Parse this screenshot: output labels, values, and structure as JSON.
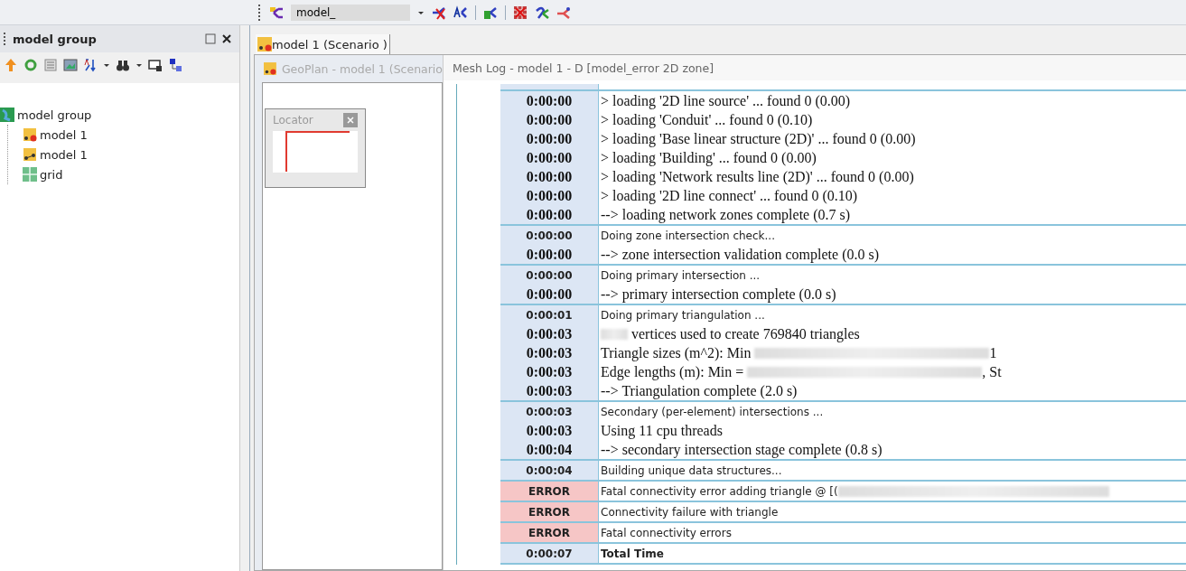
{
  "toolbar": {
    "model_field": {
      "value": "model_"
    }
  },
  "side_panel": {
    "title": "model group",
    "tree": [
      {
        "label": "model group",
        "kind": "group",
        "children": [
          {
            "label": "model 1",
            "kind": "model-error",
            "selected": false
          },
          {
            "label": "model 1",
            "kind": "model",
            "selected": false
          },
          {
            "label": "grid",
            "kind": "grid",
            "selected": false
          }
        ]
      }
    ]
  },
  "document_tab": {
    "label": "model 1 (Scenario )"
  },
  "geoplan": {
    "title": "GeoPlan - model 1 (Scenario",
    "locator": {
      "title": "Locator"
    }
  },
  "mesh_log": {
    "title": "Mesh Log - model 1 - D [model_error 2D zone]",
    "groups": [
      {
        "rows": [
          {
            "kind": "detail",
            "time": "0:00:00",
            "parts": [
              {
                "text": "> loading '2D line source' ... found 0 (0.00)"
              }
            ]
          },
          {
            "kind": "detail",
            "time": "0:00:00",
            "parts": [
              {
                "text": "> loading 'Conduit' ... found 0 (0.10)"
              }
            ]
          },
          {
            "kind": "detail",
            "time": "0:00:00",
            "parts": [
              {
                "text": "> loading 'Base linear structure (2D)' ... found 0 (0.00)"
              }
            ]
          },
          {
            "kind": "detail",
            "time": "0:00:00",
            "parts": [
              {
                "text": "> loading 'Building' ... found 0 (0.00)"
              }
            ]
          },
          {
            "kind": "detail",
            "time": "0:00:00",
            "parts": [
              {
                "text": "> loading 'Network results line (2D)' ... found 0 (0.00)"
              }
            ]
          },
          {
            "kind": "detail",
            "time": "0:00:00",
            "parts": [
              {
                "text": "> loading '2D line connect' ... found 0 (0.10)"
              }
            ]
          },
          {
            "kind": "detail",
            "time": "0:00:00",
            "parts": [
              {
                "text": "--> loading network zones complete (0.7 s)"
              }
            ]
          }
        ]
      },
      {
        "rows": [
          {
            "kind": "heading",
            "time": "0:00:00",
            "parts": [
              {
                "text": "Doing zone intersection check..."
              }
            ]
          },
          {
            "kind": "detail",
            "time": "0:00:00",
            "parts": [
              {
                "text": "--> zone intersection validation complete (0.0 s)"
              }
            ]
          }
        ]
      },
      {
        "rows": [
          {
            "kind": "heading",
            "time": "0:00:00",
            "parts": [
              {
                "text": "Doing primary intersection ..."
              }
            ]
          },
          {
            "kind": "detail",
            "time": "0:00:00",
            "parts": [
              {
                "text": "--> primary intersection complete (0.0 s)"
              }
            ]
          }
        ]
      },
      {
        "rows": [
          {
            "kind": "heading",
            "time": "0:00:01",
            "parts": [
              {
                "text": "Doing primary triangulation ..."
              }
            ]
          },
          {
            "kind": "detail",
            "time": "0:00:03",
            "parts": [
              {
                "kind": "blurred"
              },
              {
                "text": " vertices used to create 769840 triangles"
              }
            ]
          },
          {
            "kind": "detail",
            "time": "0:00:03",
            "parts": [
              {
                "text": "Triangle sizes (m^2): Min "
              },
              {
                "kind": "blurred"
              },
              {
                "text": "1"
              }
            ]
          },
          {
            "kind": "detail",
            "time": "0:00:03",
            "parts": [
              {
                "text": "Edge lengths (m): Min = "
              },
              {
                "kind": "blurred"
              },
              {
                "text": ", St"
              }
            ]
          },
          {
            "kind": "detail",
            "time": "0:00:03",
            "parts": [
              {
                "text": "--> Triangulation complete (2.0 s)"
              }
            ]
          }
        ]
      },
      {
        "rows": [
          {
            "kind": "heading",
            "time": "0:00:03",
            "parts": [
              {
                "text": "Secondary (per-element) intersections ..."
              }
            ]
          },
          {
            "kind": "detail",
            "time": "0:00:03",
            "parts": [
              {
                "text": "Using 11 cpu threads"
              }
            ]
          },
          {
            "kind": "detail",
            "time": "0:00:04",
            "parts": [
              {
                "text": "--> secondary intersection stage complete (0.8 s)"
              }
            ]
          }
        ]
      },
      {
        "rows": [
          {
            "kind": "heading",
            "time": "0:00:04",
            "parts": [
              {
                "text": "Building unique data structures..."
              }
            ]
          }
        ]
      },
      {
        "rows": [
          {
            "kind": "error",
            "time": "ERROR",
            "parts": [
              {
                "text": "Fatal connectivity error adding triangle @ [("
              },
              {
                "kind": "blurred"
              }
            ]
          }
        ]
      },
      {
        "rows": [
          {
            "kind": "error",
            "time": "ERROR",
            "parts": [
              {
                "text": "Connectivity failure with triangle"
              }
            ]
          }
        ]
      },
      {
        "rows": [
          {
            "kind": "error",
            "time": "ERROR",
            "parts": [
              {
                "text": "Fatal connectivity errors"
              }
            ]
          }
        ]
      },
      {
        "rows": [
          {
            "kind": "total",
            "time": "0:00:07",
            "parts": [
              {
                "text": "Total Time"
              }
            ]
          }
        ]
      }
    ]
  }
}
